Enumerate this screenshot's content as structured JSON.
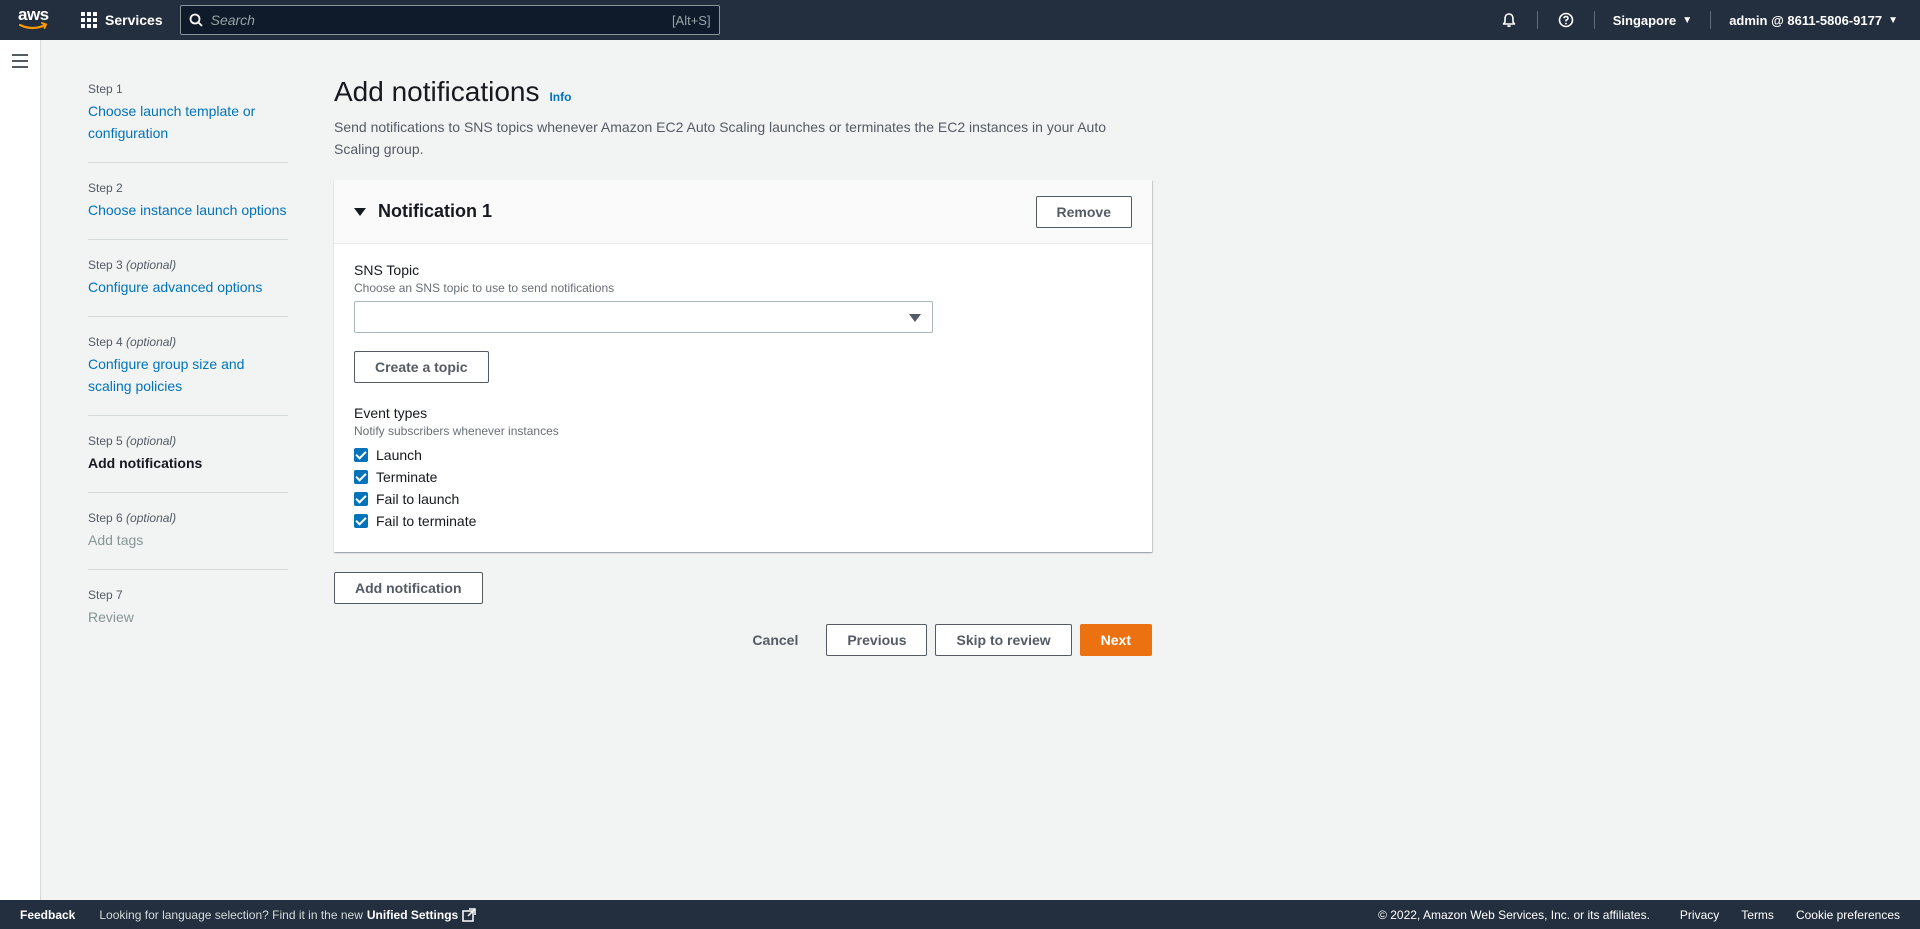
{
  "topnav": {
    "logo_text": "aws",
    "services_label": "Services",
    "search_placeholder": "Search",
    "search_shortcut": "[Alt+S]",
    "region": "Singapore",
    "account": "admin @ 8611-5806-9177"
  },
  "steps": [
    {
      "num": "Step 1",
      "optional": "",
      "label": "Choose launch template or configuration",
      "state": "link"
    },
    {
      "num": "Step 2",
      "optional": "",
      "label": "Choose instance launch options",
      "state": "link"
    },
    {
      "num": "Step 3",
      "optional": "(optional)",
      "label": "Configure advanced options",
      "state": "link"
    },
    {
      "num": "Step 4",
      "optional": "(optional)",
      "label": "Configure group size and scaling policies",
      "state": "link"
    },
    {
      "num": "Step 5",
      "optional": "(optional)",
      "label": "Add notifications",
      "state": "current"
    },
    {
      "num": "Step 6",
      "optional": "(optional)",
      "label": "Add tags",
      "state": "disabled"
    },
    {
      "num": "Step 7",
      "optional": "",
      "label": "Review",
      "state": "disabled"
    }
  ],
  "main": {
    "title": "Add notifications",
    "info": "Info",
    "description": "Send notifications to SNS topics whenever Amazon EC2 Auto Scaling launches or terminates the EC2 instances in your Auto Scaling group.",
    "notification": {
      "title": "Notification 1",
      "remove_label": "Remove",
      "sns_label": "SNS Topic",
      "sns_desc": "Choose an SNS topic to use to send notifications",
      "sns_value": "",
      "create_topic_label": "Create a topic",
      "event_label": "Event types",
      "event_desc": "Notify subscribers whenever instances",
      "events": [
        {
          "label": "Launch",
          "checked": true
        },
        {
          "label": "Terminate",
          "checked": true
        },
        {
          "label": "Fail to launch",
          "checked": true
        },
        {
          "label": "Fail to terminate",
          "checked": true
        }
      ]
    },
    "add_notification_label": "Add notification",
    "actions": {
      "cancel": "Cancel",
      "previous": "Previous",
      "skip": "Skip to review",
      "next": "Next"
    }
  },
  "footer": {
    "feedback": "Feedback",
    "language_text": "Looking for language selection? Find it in the new",
    "unified_settings": "Unified Settings",
    "copyright": "© 2022, Amazon Web Services, Inc. or its affiliates.",
    "privacy": "Privacy",
    "terms": "Terms",
    "cookies": "Cookie preferences"
  },
  "colors": {
    "nav_bg": "#232f3e",
    "link": "#0073bb",
    "primary": "#ec7211",
    "page_bg": "#f2f3f3"
  }
}
